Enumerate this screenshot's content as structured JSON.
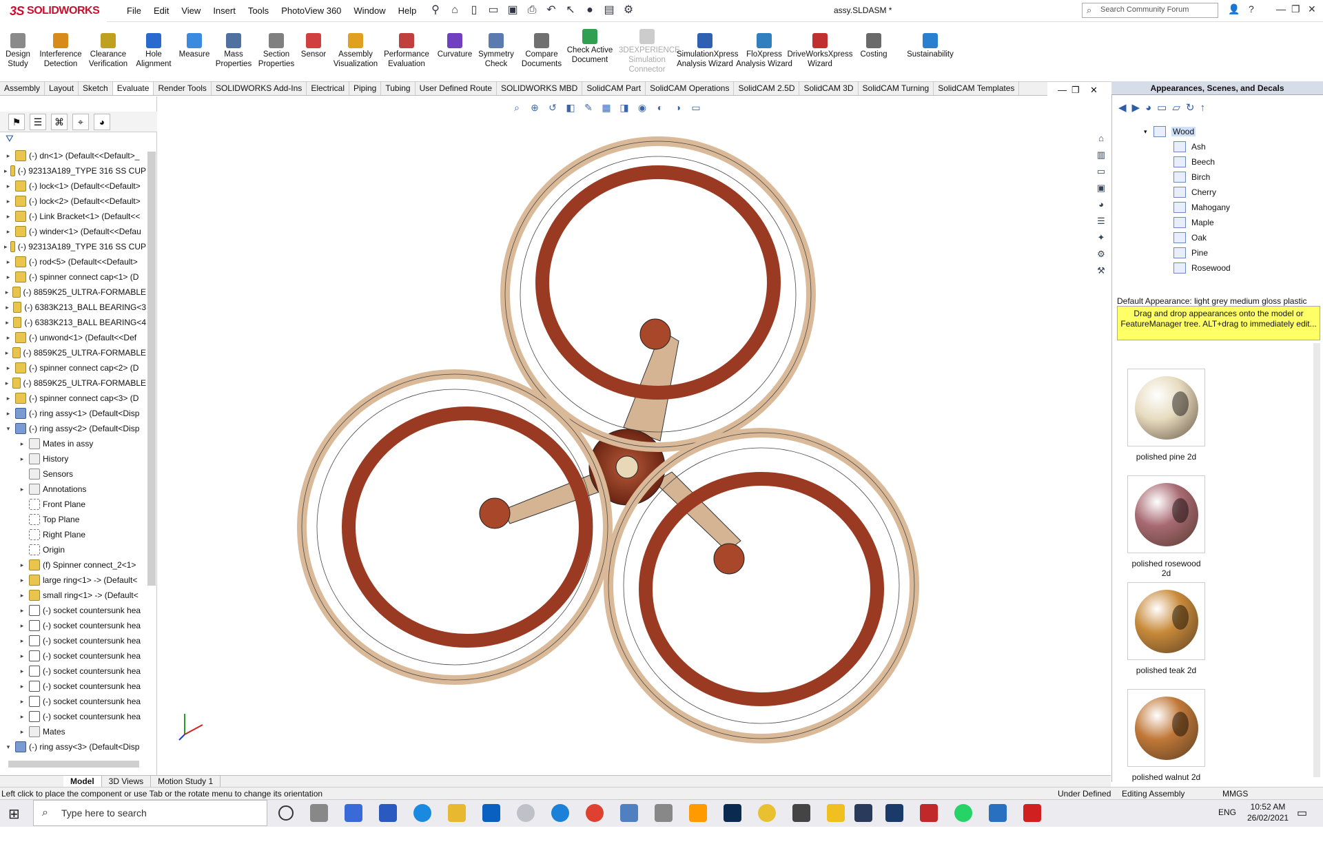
{
  "app": {
    "name": "SOLIDWORKS",
    "logo_prefix": "3S",
    "document": "assy.SLDASM *"
  },
  "menu": [
    "File",
    "Edit",
    "View",
    "Insert",
    "Tools",
    "PhotoView 360",
    "Window",
    "Help"
  ],
  "search": {
    "placeholder": "Search Community Forum"
  },
  "ribbon": [
    {
      "label": "Design Study",
      "color": "#8a8a8a"
    },
    {
      "label": "Interference Detection",
      "color": "#d88a1a"
    },
    {
      "label": "Clearance Verification",
      "color": "#c0a020"
    },
    {
      "label": "Hole Alignment",
      "color": "#2a6ad0"
    },
    {
      "label": "Measure",
      "color": "#3a8ae0"
    },
    {
      "label": "Mass Properties",
      "color": "#5070a0"
    },
    {
      "label": "Section Properties",
      "color": "#808080"
    },
    {
      "label": "Sensor",
      "color": "#d04040"
    },
    {
      "label": "Assembly Visualization",
      "color": "#e0a020"
    },
    {
      "label": "Performance Evaluation",
      "color": "#c04040"
    },
    {
      "label": "Curvature",
      "color": "#7040c0"
    },
    {
      "label": "Symmetry Check",
      "color": "#5a7ab0"
    },
    {
      "label": "Compare Documents",
      "color": "#707070"
    },
    {
      "label": "Check Active Document",
      "color": "#30a050"
    },
    {
      "label": "3DEXPERIENCE Simulation Connector",
      "color": "#cccccc",
      "disabled": true
    },
    {
      "label": "SimulationXpress Analysis Wizard",
      "color": "#3060b0"
    },
    {
      "label": "FloXpress Analysis Wizard",
      "color": "#3080c0"
    },
    {
      "label": "DriveWorksXpress Wizard",
      "color": "#c03030"
    },
    {
      "label": "Costing",
      "color": "#6a6a6a"
    },
    {
      "label": "Sustainability",
      "color": "#2a80d0"
    }
  ],
  "cmd_tabs": [
    "Assembly",
    "Layout",
    "Sketch",
    "Evaluate",
    "Render Tools",
    "SOLIDWORKS Add-Ins",
    "Electrical",
    "Piping",
    "Tubing",
    "User Defined Route",
    "SOLIDWORKS MBD",
    "SolidCAM Part",
    "SolidCAM Operations",
    "SolidCAM 2.5D",
    "SolidCAM 3D",
    "SolidCAM Turning",
    "SolidCAM Templates"
  ],
  "active_cmd_tab": "Evaluate",
  "tree": [
    {
      "label": "(-) dn<1> (Default<<Default>_",
      "icon": "part",
      "level": 0,
      "exp": "▸"
    },
    {
      "label": "(-) 92313A189_TYPE 316 SS CUP",
      "icon": "part",
      "level": 0,
      "exp": "▸"
    },
    {
      "label": "(-) lock<1> (Default<<Default>",
      "icon": "part",
      "level": 0,
      "exp": "▸"
    },
    {
      "label": "(-) lock<2> (Default<<Default>",
      "icon": "part",
      "level": 0,
      "exp": "▸"
    },
    {
      "label": "(-) Link Bracket<1> (Default<<",
      "icon": "part",
      "level": 0,
      "exp": "▸"
    },
    {
      "label": "(-) winder<1> (Default<<Defau",
      "icon": "part",
      "level": 0,
      "exp": "▸"
    },
    {
      "label": "(-) 92313A189_TYPE 316 SS CUP",
      "icon": "part",
      "level": 0,
      "exp": "▸"
    },
    {
      "label": "(-) rod<5> (Default<<Default>",
      "icon": "part",
      "level": 0,
      "exp": "▸"
    },
    {
      "label": "(-) spinner connect cap<1> (D",
      "icon": "part",
      "level": 0,
      "exp": "▸"
    },
    {
      "label": "(-) 8859K25_ULTRA-FORMABLE",
      "icon": "part",
      "level": 0,
      "exp": "▸"
    },
    {
      "label": "(-) 6383K213_BALL BEARING<3",
      "icon": "part",
      "level": 0,
      "exp": "▸"
    },
    {
      "label": "(-) 6383K213_BALL BEARING<4",
      "icon": "part",
      "level": 0,
      "exp": "▸"
    },
    {
      "label": "(-) unwond<1> (Default<<Def",
      "icon": "part",
      "level": 0,
      "exp": "▸"
    },
    {
      "label": "(-) 8859K25_ULTRA-FORMABLE",
      "icon": "part",
      "level": 0,
      "exp": "▸"
    },
    {
      "label": "(-) spinner connect cap<2> (D",
      "icon": "part",
      "level": 0,
      "exp": "▸"
    },
    {
      "label": "(-) 8859K25_ULTRA-FORMABLE",
      "icon": "part",
      "level": 0,
      "exp": "▸"
    },
    {
      "label": "(-) spinner connect cap<3> (D",
      "icon": "part",
      "level": 0,
      "exp": "▸"
    },
    {
      "label": "(-) ring assy<1> (Default<Disp",
      "icon": "asm",
      "level": 0,
      "exp": "▸"
    },
    {
      "label": "(-) ring assy<2> (Default<Disp",
      "icon": "asm",
      "level": 0,
      "exp": "▾"
    },
    {
      "label": "Mates in assy",
      "icon": "folder",
      "level": 1,
      "exp": "▸"
    },
    {
      "label": "History",
      "icon": "folder",
      "level": 1,
      "exp": "▸"
    },
    {
      "label": "Sensors",
      "icon": "folder",
      "level": 1,
      "exp": ""
    },
    {
      "label": "Annotations",
      "icon": "folder",
      "level": 1,
      "exp": "▸"
    },
    {
      "label": "Front Plane",
      "icon": "plane",
      "level": 1,
      "exp": ""
    },
    {
      "label": "Top Plane",
      "icon": "plane",
      "level": 1,
      "exp": ""
    },
    {
      "label": "Right Plane",
      "icon": "plane",
      "level": 1,
      "exp": ""
    },
    {
      "label": "Origin",
      "icon": "plane",
      "level": 1,
      "exp": ""
    },
    {
      "label": "(f) Spinner connect_2<1>",
      "icon": "part",
      "level": 1,
      "exp": "▸"
    },
    {
      "label": "large ring<1> -> (Default<",
      "icon": "part",
      "level": 1,
      "exp": "▸"
    },
    {
      "label": "small ring<1> -> (Default<",
      "icon": "part",
      "level": 1,
      "exp": "▸"
    },
    {
      "label": "(-) socket countersunk hea",
      "icon": "screw",
      "level": 1,
      "exp": "▸"
    },
    {
      "label": "(-) socket countersunk hea",
      "icon": "screw",
      "level": 1,
      "exp": "▸"
    },
    {
      "label": "(-) socket countersunk hea",
      "icon": "screw",
      "level": 1,
      "exp": "▸"
    },
    {
      "label": "(-) socket countersunk hea",
      "icon": "screw",
      "level": 1,
      "exp": "▸"
    },
    {
      "label": "(-) socket countersunk hea",
      "icon": "screw",
      "level": 1,
      "exp": "▸"
    },
    {
      "label": "(-) socket countersunk hea",
      "icon": "screw",
      "level": 1,
      "exp": "▸"
    },
    {
      "label": "(-) socket countersunk hea",
      "icon": "screw",
      "level": 1,
      "exp": "▸"
    },
    {
      "label": "(-) socket countersunk hea",
      "icon": "screw",
      "level": 1,
      "exp": "▸"
    },
    {
      "label": "Mates",
      "icon": "folder",
      "level": 1,
      "exp": "▸"
    },
    {
      "label": "(-) ring assy<3> (Default<Disp",
      "icon": "asm",
      "level": 0,
      "exp": "▾"
    }
  ],
  "right_panel": {
    "title": "Appearances, Scenes, and Decals",
    "folder": "Wood",
    "wood_items": [
      "Ash",
      "Beech",
      "Birch",
      "Cherry",
      "Mahogany",
      "Maple",
      "Oak",
      "Pine",
      "Rosewood"
    ],
    "default_appearance": "Default Appearance: light grey medium gloss plastic",
    "tip": "Drag and drop appearances onto the model or FeatureManager tree.  ALT+drag to immediately edit...",
    "swatches": [
      {
        "label": "polished pine 2d",
        "color": "#e8dcc0"
      },
      {
        "label": "polished rosewood 2d",
        "color": "#a86a72"
      },
      {
        "label": "polished teak 2d",
        "color": "#c88a3a"
      },
      {
        "label": "polished walnut 2d",
        "color": "#c07838"
      }
    ]
  },
  "bottom_tabs": [
    "Model",
    "3D Views",
    "Motion Study 1"
  ],
  "active_bottom_tab": "Model",
  "status": {
    "message": "Left click to place the component or use Tab or the rotate menu to change its orientation",
    "state": "Under Defined",
    "mode": "Editing Assembly",
    "units": "MMGS"
  },
  "taskbar": {
    "search_placeholder": "Type here to search",
    "lang": "ENG",
    "time": "10:52 AM",
    "date": "26/02/2021"
  },
  "colors": {
    "ring_outer": "#d9b998",
    "ring_inner": "#9a3a22",
    "accent": "#c8102e"
  }
}
